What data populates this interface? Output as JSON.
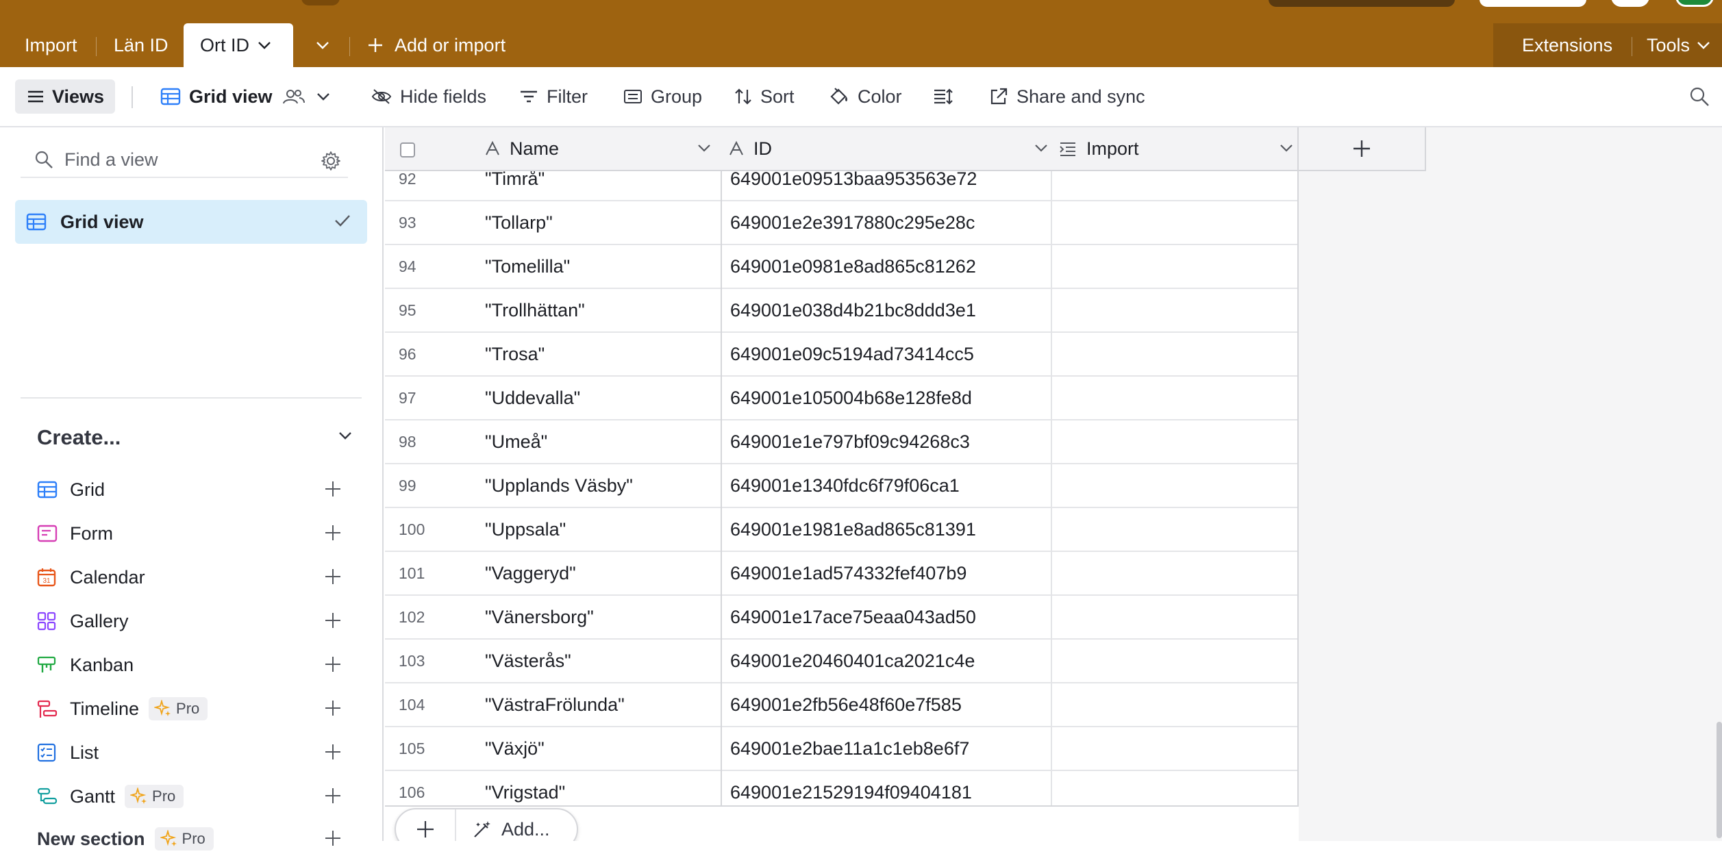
{
  "tabs": {
    "import": "Import",
    "lan_id": "Län ID",
    "active": "Ort ID",
    "add_or_import": "Add or import",
    "extensions": "Extensions",
    "tools": "Tools"
  },
  "toolbar": {
    "views": "Views",
    "grid_view": "Grid view",
    "hide_fields": "Hide fields",
    "filter": "Filter",
    "group": "Group",
    "sort": "Sort",
    "color": "Color",
    "share_and_sync": "Share and sync"
  },
  "sidebar": {
    "find_placeholder": "Find a view",
    "selected_view": "Grid view",
    "create_label": "Create...",
    "create_items": [
      {
        "label": "Grid",
        "icon": "grid-icon",
        "color": "#2d7ff9",
        "pro": ""
      },
      {
        "label": "Form",
        "icon": "form-icon",
        "color": "#d63fb5",
        "pro": ""
      },
      {
        "label": "Calendar",
        "icon": "calendar-icon",
        "color": "#e8571b",
        "pro": ""
      },
      {
        "label": "Gallery",
        "icon": "gallery-icon",
        "color": "#8b46ff",
        "pro": ""
      },
      {
        "label": "Kanban",
        "icon": "kanban-icon",
        "color": "#20a942",
        "pro": ""
      },
      {
        "label": "Timeline",
        "icon": "timeline-icon",
        "color": "#e3294e",
        "pro": "Pro"
      },
      {
        "label": "List",
        "icon": "list-icon",
        "color": "#1f6fe0",
        "pro": ""
      },
      {
        "label": "Gantt",
        "icon": "gantt-icon",
        "color": "#129f9f",
        "pro": "Pro"
      },
      {
        "label": "New section",
        "icon": "",
        "color": "",
        "pro": "Pro"
      }
    ]
  },
  "grid": {
    "columns": {
      "name": "Name",
      "id": "ID",
      "import": "Import"
    },
    "rows": [
      {
        "num": "92",
        "name": "\"Timrå\"",
        "id": "649001e09513baa953563e72"
      },
      {
        "num": "93",
        "name": "\"Tollarp\"",
        "id": "649001e2e3917880c295e28c"
      },
      {
        "num": "94",
        "name": "\"Tomelilla\"",
        "id": "649001e0981e8ad865c81262"
      },
      {
        "num": "95",
        "name": "\"Trollhättan\"",
        "id": "649001e038d4b21bc8ddd3e1"
      },
      {
        "num": "96",
        "name": "\"Trosa\"",
        "id": "649001e09c5194ad73414cc5"
      },
      {
        "num": "97",
        "name": "\"Uddevalla\"",
        "id": "649001e105004b68e128fe8d"
      },
      {
        "num": "98",
        "name": "\"Umeå\"",
        "id": "649001e1e797bf09c94268c3"
      },
      {
        "num": "99",
        "name": "\"Upplands Väsby\"",
        "id": "649001e1340fdc6f79f06ca1"
      },
      {
        "num": "100",
        "name": "\"Uppsala\"",
        "id": "649001e1981e8ad865c81391"
      },
      {
        "num": "101",
        "name": "\"Vaggeryd\"",
        "id": "649001e1ad574332fef407b9"
      },
      {
        "num": "102",
        "name": "\"Vänersborg\"",
        "id": "649001e17ace75eaa043ad50"
      },
      {
        "num": "103",
        "name": "\"Västerås\"",
        "id": "649001e20460401ca2021c4e"
      },
      {
        "num": "104",
        "name": "\"VästraFrölunda\"",
        "id": "649001e2fb56e48f60e7f585"
      },
      {
        "num": "105",
        "name": "\"Växjö\"",
        "id": "649001e2bae11a1c1eb8e6f7"
      },
      {
        "num": "106",
        "name": "\"Vrigstad\"",
        "id": "649001e21529194f09404181"
      }
    ],
    "add_label": "Add..."
  }
}
